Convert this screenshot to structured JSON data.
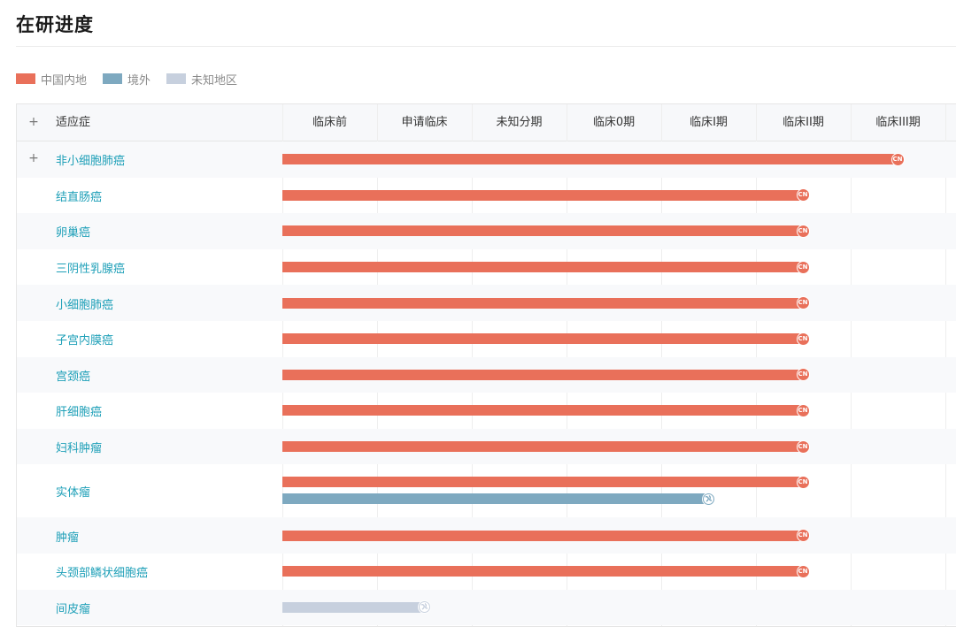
{
  "page": {
    "title": "在研进度"
  },
  "legend": [
    {
      "label": "中国内地",
      "color": "#e9705a"
    },
    {
      "label": "境外",
      "color": "#7ea9c0"
    },
    {
      "label": "未知地区",
      "color": "#c7d0de"
    }
  ],
  "table": {
    "indication_header": "适应症",
    "phases": [
      "临床前",
      "申请临床",
      "未知分期",
      "临床0期",
      "临床I期",
      "临床II期",
      "临床III期"
    ],
    "rows": [
      {
        "name": "非小细胞肺癌",
        "expandable": true,
        "bars": [
          {
            "region": "中国内地",
            "phase_reached": "临床III期",
            "icon": "CN"
          }
        ]
      },
      {
        "name": "结直肠癌",
        "bars": [
          {
            "region": "中国内地",
            "phase_reached": "临床II期",
            "icon": "CN"
          }
        ]
      },
      {
        "name": "卵巢癌",
        "bars": [
          {
            "region": "中国内地",
            "phase_reached": "临床II期",
            "icon": "CN"
          }
        ]
      },
      {
        "name": "三阴性乳腺癌",
        "bars": [
          {
            "region": "中国内地",
            "phase_reached": "临床II期",
            "icon": "CN"
          }
        ]
      },
      {
        "name": "小细胞肺癌",
        "bars": [
          {
            "region": "中国内地",
            "phase_reached": "临床II期",
            "icon": "CN"
          }
        ]
      },
      {
        "name": "子宫内膜癌",
        "bars": [
          {
            "region": "中国内地",
            "phase_reached": "临床II期",
            "icon": "CN"
          }
        ]
      },
      {
        "name": "宫颈癌",
        "bars": [
          {
            "region": "中国内地",
            "phase_reached": "临床II期",
            "icon": "CN"
          }
        ]
      },
      {
        "name": "肝细胞癌",
        "bars": [
          {
            "region": "中国内地",
            "phase_reached": "临床II期",
            "icon": "CN"
          }
        ]
      },
      {
        "name": "妇科肿瘤",
        "bars": [
          {
            "region": "中国内地",
            "phase_reached": "临床II期",
            "icon": "CN"
          }
        ]
      },
      {
        "name": "实体瘤",
        "bars": [
          {
            "region": "中国内地",
            "phase_reached": "临床II期",
            "icon": "CN"
          },
          {
            "region": "境外",
            "phase_reached": "临床I期",
            "icon": "globe"
          }
        ]
      },
      {
        "name": "肿瘤",
        "bars": [
          {
            "region": "中国内地",
            "phase_reached": "临床II期",
            "icon": "CN"
          }
        ]
      },
      {
        "name": "头颈部鳞状细胞癌",
        "bars": [
          {
            "region": "中国内地",
            "phase_reached": "临床II期",
            "icon": "CN"
          }
        ]
      },
      {
        "name": "间皮瘤",
        "bars": [
          {
            "region": "未知地区",
            "phase_reached": "申请临床",
            "icon": "globe"
          }
        ]
      }
    ]
  }
}
